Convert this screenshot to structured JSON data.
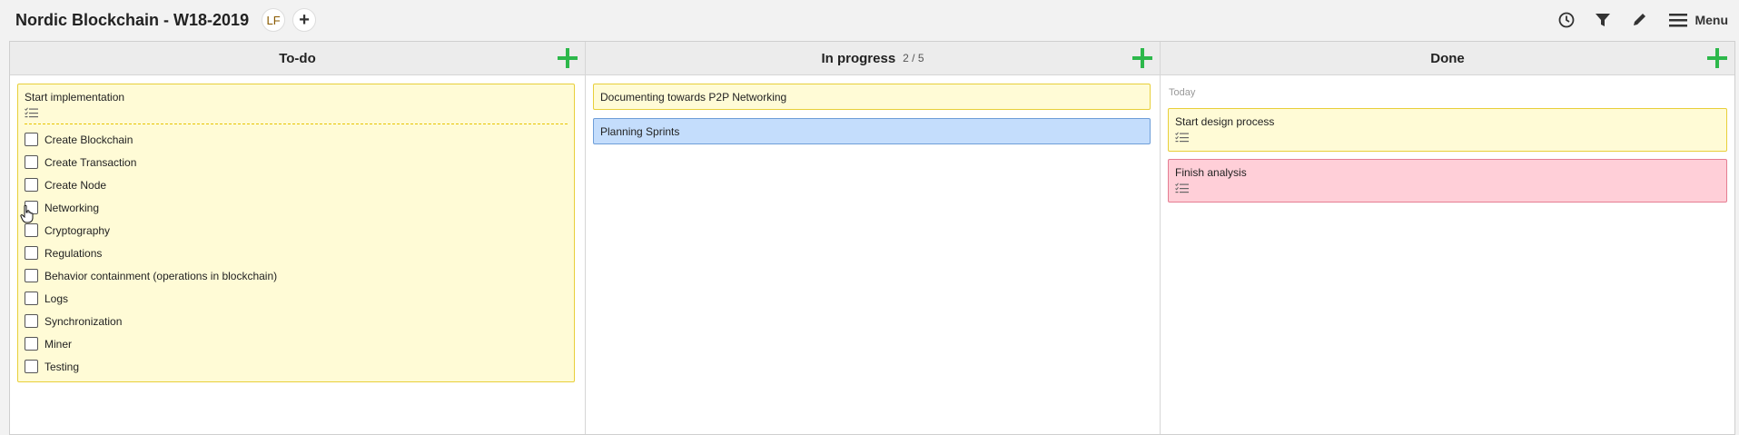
{
  "header": {
    "title": "Nordic Blockchain - W18-2019",
    "avatar_initials": "LF",
    "add_member_symbol": "+",
    "menu_label": "Menu",
    "icons": [
      "clock-icon",
      "filter-icon",
      "pencil-icon",
      "hamburger-icon"
    ]
  },
  "columns": [
    {
      "title": "To-do",
      "wip": ""
    },
    {
      "title": "In progress",
      "wip": "2 / 5"
    },
    {
      "title": "Done",
      "wip": "",
      "section_label": "Today"
    }
  ],
  "todo": {
    "card_title": "Start implementation",
    "checklist": [
      "Create Blockchain",
      "Create Transaction",
      "Create Node",
      "Networking",
      "Cryptography",
      "Regulations",
      "Behavior containment (operations in blockchain)",
      "Logs",
      "Synchronization",
      "Miner",
      "Testing"
    ]
  },
  "in_progress": {
    "cards": [
      "Documenting towards P2P Networking",
      "Planning Sprints"
    ]
  },
  "done": {
    "cards": [
      "Start design process",
      "Finish analysis"
    ]
  },
  "colors": {
    "card_yellow": "#fffbd6",
    "card_yellow_border": "#e8cf3a",
    "card_blue": "#c4ddfc",
    "card_blue_border": "#6e9ed8",
    "card_pink": "#ffcfd8",
    "card_pink_border": "#e57d92",
    "add_green": "#2db84b"
  }
}
